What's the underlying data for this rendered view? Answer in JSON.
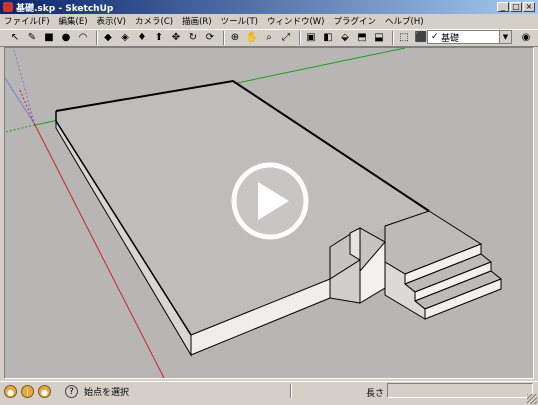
{
  "window": {
    "title": "基礎.skp - SketchUp"
  },
  "menu": [
    "ファイル(F)",
    "編集(E)",
    "表示(V)",
    "カメラ(C)",
    "描画(R)",
    "ツール(T)",
    "ウィンドウ(W)",
    "プラグイン",
    "ヘルプ(H)"
  ],
  "toolbar": {
    "tools": [
      {
        "name": "select-tool-icon",
        "glyph": "↖"
      },
      {
        "name": "pencil-tool-icon",
        "glyph": "✎"
      },
      {
        "name": "rectangle-tool-icon",
        "glyph": "■"
      },
      {
        "name": "circle-tool-icon",
        "glyph": "●"
      },
      {
        "name": "arc-tool-icon",
        "glyph": "◠"
      },
      {
        "name": "eraser-tool-icon",
        "glyph": "◆"
      },
      {
        "name": "tape-measure-tool-icon",
        "glyph": "◈"
      },
      {
        "name": "paint-bucket-tool-icon",
        "glyph": "♦"
      },
      {
        "name": "push-pull-tool-icon",
        "glyph": "⬆"
      },
      {
        "name": "move-tool-icon",
        "glyph": "✥"
      },
      {
        "name": "rotate-tool-icon",
        "glyph": "↻"
      },
      {
        "name": "offset-tool-icon",
        "glyph": "⟳"
      },
      {
        "name": "orbit-tool-icon",
        "glyph": "⊕"
      },
      {
        "name": "pan-tool-icon",
        "glyph": "✋"
      },
      {
        "name": "zoom-tool-icon",
        "glyph": "⌕"
      },
      {
        "name": "zoom-extents-tool-icon",
        "glyph": "⤢"
      },
      {
        "name": "components-icon",
        "glyph": "▣"
      },
      {
        "name": "materials-icon",
        "glyph": "◧"
      },
      {
        "name": "iso-view-icon",
        "glyph": "⬙"
      },
      {
        "name": "top-view-icon",
        "glyph": "⬒"
      },
      {
        "name": "front-view-icon",
        "glyph": "⬓"
      },
      {
        "name": "get-models-icon",
        "glyph": "⬚"
      },
      {
        "name": "share-model-icon",
        "glyph": "⬛"
      },
      {
        "name": "warehouse-icon",
        "glyph": "⌂"
      }
    ]
  },
  "layer": {
    "current": "基礎",
    "checked": "✓"
  },
  "status": {
    "text": "始点を選択",
    "measure_label": "長さ",
    "measure_value": ""
  },
  "icons": {
    "geo_icon": "geo-location-icon",
    "credits_icon": "credits-icon",
    "user_icon": "user-icon",
    "help_icon": "help-icon"
  },
  "video": {
    "play_glyph": "▶"
  }
}
